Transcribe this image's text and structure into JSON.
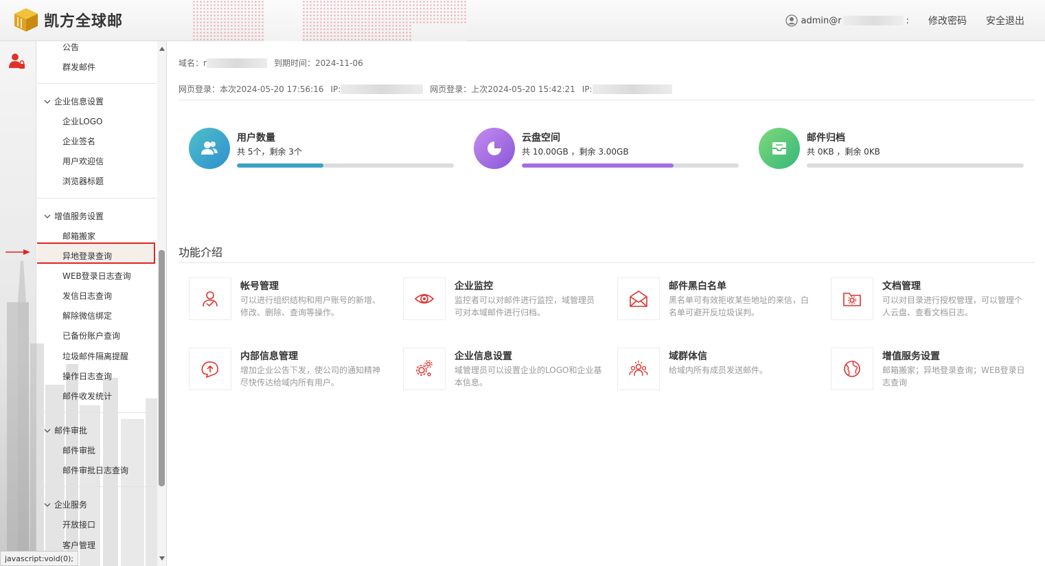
{
  "header": {
    "brand": "凯方全球邮",
    "user_prefix": "admin@r",
    "user_suffix": ":",
    "change_password": "修改密码",
    "logout": "安全退出"
  },
  "sidebar": {
    "items_top": [
      "公告",
      "群发邮件"
    ],
    "groups": [
      {
        "title": "企业信息设置",
        "items": [
          "企业LOGO",
          "企业签名",
          "用户欢迎信",
          "浏览器标题"
        ]
      },
      {
        "title": "增值服务设置",
        "items": [
          "邮箱搬家",
          "异地登录查询",
          "WEB登录日志查询",
          "发信日志查询",
          "解除微信绑定",
          "已备份账户查询",
          "垃圾邮件隔离提醒",
          "操作日志查询",
          "邮件收发统计"
        ]
      },
      {
        "title": "邮件审批",
        "items": [
          "邮件审批",
          "邮件审批日志查询"
        ]
      },
      {
        "title": "企业服务",
        "items": [
          "开放接口",
          "客户管理"
        ]
      }
    ],
    "selected_item": "异地登录查询"
  },
  "status_bar": "javascript:void(0);",
  "info": {
    "domain_label": "域名：",
    "domain_prefix": "r",
    "expire_label": "到期时间：",
    "expire_value": "2024-11-06",
    "login_this_label": "网页登录：本次",
    "login_this_time": "2024-05-20 17:56:16",
    "ip_label": "IP:",
    "login_last_label": "网页登录：上次",
    "login_last_time": "2024-05-20 15:42:21",
    "ip_label2": "IP:"
  },
  "stats": [
    {
      "title": "用户数量",
      "sub": "共 5个，剩余 3个",
      "fill": 0.4,
      "color": "#3aa3c4",
      "icon": "users-icon"
    },
    {
      "title": "云盘空间",
      "sub": "共 10.00GB ，剩余 3.00GB",
      "fill": 0.7,
      "color": "#a66ee0",
      "icon": "pie-icon"
    },
    {
      "title": "邮件归档",
      "sub": "共 0KB ，剩余 0KB",
      "fill": 0.0,
      "color": "#4fbf73",
      "icon": "inbox-icon"
    }
  ],
  "features_section_title": "功能介绍",
  "features": [
    {
      "title": "帐号管理",
      "desc": "可以进行组织结构和用户账号的新增、修改、删除、查询等操作。",
      "icon": "account-icon"
    },
    {
      "title": "企业监控",
      "desc": "监控者可以对邮件进行监控，域管理员可对本域邮件进行归档。",
      "icon": "eye-icon"
    },
    {
      "title": "邮件黑白名单",
      "desc": "黑名单可有效拒收某些地址的来信，白名单可避开反垃圾误判。",
      "icon": "mail-icon"
    },
    {
      "title": "文档管理",
      "desc": "可以对目录进行授权管理，可以管理个人云盘、查看文档日志。",
      "icon": "folder-gear-icon"
    },
    {
      "title": "内部信息管理",
      "desc": "增加企业公告下发，使公司的通知精神尽快传达给域内所有用户。",
      "icon": "chat-upload-icon"
    },
    {
      "title": "企业信息设置",
      "desc": "域管理员可以设置企业的LOGO和企业基本信息。",
      "icon": "gears-icon"
    },
    {
      "title": "域群体信",
      "desc": "给域内所有成员发送邮件。",
      "icon": "group-icon"
    },
    {
      "title": "增值服务设置",
      "desc": "邮箱搬家；异地登录查询；WEB登录日志查询",
      "icon": "globe-icon"
    }
  ],
  "colors": {
    "accent_red": "#e0312b",
    "selected_border": "#e02424"
  }
}
